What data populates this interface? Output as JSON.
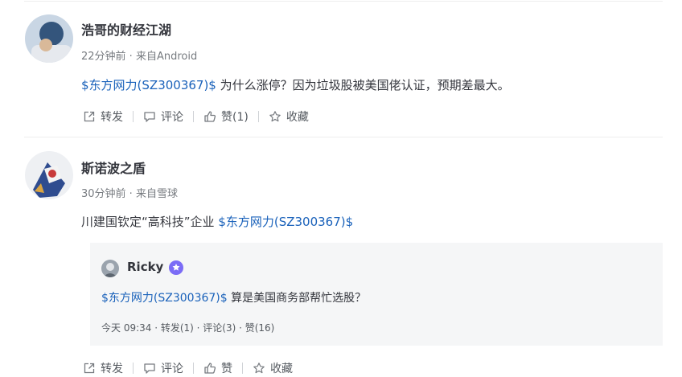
{
  "posts": [
    {
      "author": "浩哥的财经江湖",
      "meta": "22分钟前 · 来自Android",
      "stock_link": "$东方网力(SZ300367)$",
      "text": " 为什么涨停？因为垃圾股被美国佬认证，预期差最大。",
      "actions": {
        "repost": "转发",
        "comment": "评论",
        "like": "赞(1)",
        "favorite": "收藏"
      }
    },
    {
      "author": "斯诺波之盾",
      "meta": "30分钟前 · 来自雪球",
      "text": "川建国钦定“高科技”企业 ",
      "stock_link": "$东方网力(SZ300367)$",
      "quote": {
        "author": "Ricky",
        "stock_link": "$东方网力(SZ300367)$",
        "text": " 算是美国商务部帮忙选股？",
        "meta": "今天 09:34  · 转发(1) · 评论(3) · 赞(16)"
      },
      "actions": {
        "repost": "转发",
        "comment": "评论",
        "like": "赞",
        "favorite": "收藏"
      }
    }
  ],
  "icons": {
    "repost": "repost-icon",
    "comment": "comment-icon",
    "like": "thumbs-up-icon",
    "favorite": "star-icon",
    "verified": "verified-badge-icon"
  },
  "colors": {
    "link": "#1961ba",
    "text": "#33353c",
    "muted": "#777b80",
    "badge": "#7b6cf6",
    "quote_bg": "#f5f6f7"
  }
}
